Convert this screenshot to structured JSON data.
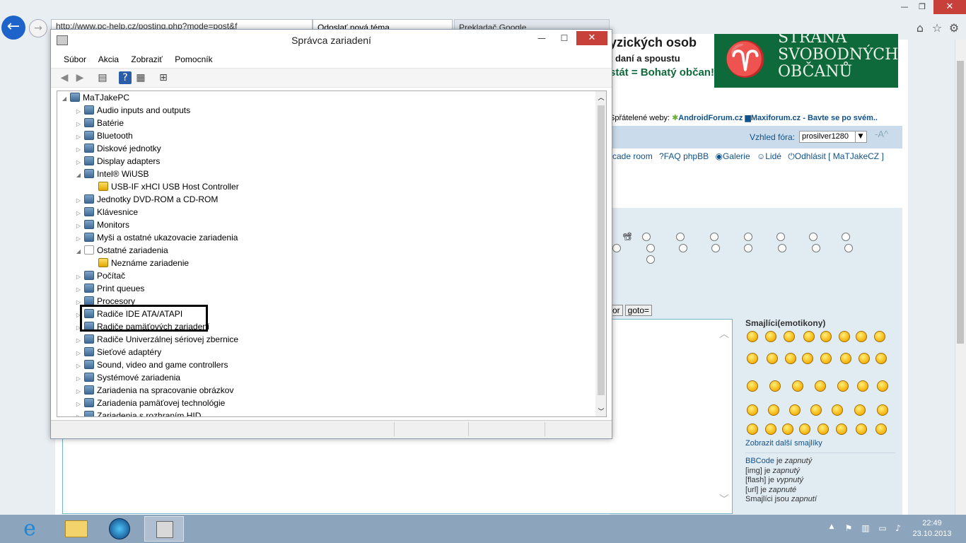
{
  "browser": {
    "address": "http://www.pc-help.cz/posting.php?mode=post&f",
    "tabs": [
      "Odoslať nová téma",
      "Prekladač Google"
    ],
    "window_controls": {
      "minimize": "—",
      "restore": "❐",
      "close": "✕"
    }
  },
  "banner": {
    "lines": [
      "yzických osob",
      "t daní a spoustu",
      "stát = Bohatý občan!"
    ],
    "party": [
      "STRANA",
      "SVOBODNÝCH",
      "OBČANŮ"
    ]
  },
  "partners": {
    "label": "Spřátelené weby:",
    "site1": "AndroidForum.cz",
    "site2": "Maxiforum.cz - Bavte se po svém.."
  },
  "forum_style": {
    "label": "Vzhled fóra:",
    "value": "prosilver1280",
    "font_controls": "-A^"
  },
  "nav_links": [
    "rcade room",
    "FAQ phpBB",
    "Galerie",
    "Lidé",
    "Odhlásit [ MaTJakeCZ ]"
  ],
  "bbcode_buttons": [
    "or",
    "goto="
  ],
  "smileys": {
    "title": "Smajlíci(emotikony)",
    "more": "Zobrazit další smajlíky",
    "status": [
      {
        "name": "BBCode",
        "mid": " je ",
        "state": "zapnutý"
      },
      {
        "name": "[img]",
        "mid": " je ",
        "state": "zapnutý"
      },
      {
        "name": "[flash]",
        "mid": " je ",
        "state": "vypnutý"
      },
      {
        "name": "[url]",
        "mid": " je ",
        "state": "zapnuté"
      },
      {
        "name": "Smajlíci",
        "mid": " jsou ",
        "state": "zapnutí"
      }
    ]
  },
  "device_manager": {
    "title": "Správca zariadení",
    "menu": [
      "Súbor",
      "Akcia",
      "Zobraziť",
      "Pomocník"
    ],
    "root": "MaTJakePC",
    "items": [
      {
        "label": "Audio inputs and outputs",
        "expanded": false
      },
      {
        "label": "Batérie",
        "expanded": false
      },
      {
        "label": "Bluetooth",
        "expanded": false
      },
      {
        "label": "Diskové jednotky",
        "expanded": false
      },
      {
        "label": "Display adapters",
        "expanded": false
      },
      {
        "label": "Intel® WiUSB",
        "expanded": true
      },
      {
        "label": "USB-IF xHCI USB Host Controller",
        "child": true,
        "warning": true
      },
      {
        "label": "Jednotky DVD-ROM a CD-ROM",
        "expanded": false
      },
      {
        "label": "Klávesnice",
        "expanded": false
      },
      {
        "label": "Monitors",
        "expanded": false
      },
      {
        "label": "Myši a ostatné ukazovacie zariadenia",
        "expanded": false
      },
      {
        "label": "Ostatné zariadenia",
        "expanded": true
      },
      {
        "label": "Neznáme zariadenie",
        "child": true,
        "warning": true
      },
      {
        "label": "Počítač",
        "expanded": false
      },
      {
        "label": "Print queues",
        "expanded": false
      },
      {
        "label": "Procesory",
        "expanded": false
      },
      {
        "label": "Radiče IDE ATA/ATAPI",
        "expanded": false
      },
      {
        "label": "Radiče pamäťových zariadení",
        "expanded": false
      },
      {
        "label": "Radiče Univerzálnej sériovej zbernice",
        "expanded": false
      },
      {
        "label": "Sieťové adaptéry",
        "expanded": false
      },
      {
        "label": "Sound, video and game controllers",
        "expanded": false
      },
      {
        "label": "Systémové zariadenia",
        "expanded": false
      },
      {
        "label": "Zariadenia na spracovanie obrázkov",
        "expanded": false
      },
      {
        "label": "Zariadenia pamäťovej technológie",
        "expanded": false
      },
      {
        "label": "Zariadenia s rozhraním HID",
        "expanded": false
      }
    ]
  },
  "taskbar": {
    "time": "22:49",
    "date": "23.10.2013"
  }
}
